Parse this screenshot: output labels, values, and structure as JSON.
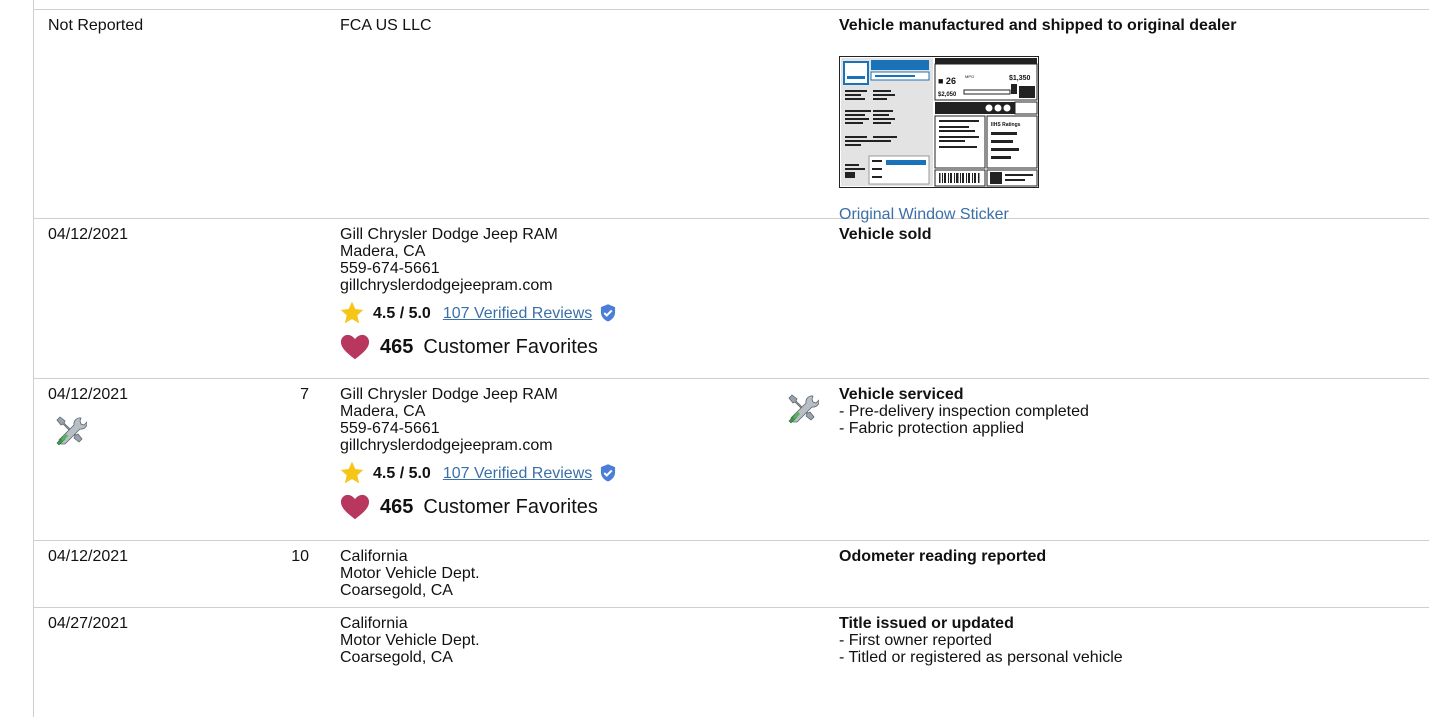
{
  "rows": [
    {
      "date": "Not Reported",
      "odometer": "",
      "source": {
        "lines": [
          "FCA US LLC"
        ]
      },
      "details": {
        "headline": "Vehicle manufactured and shipped to original dealer",
        "sticker": {
          "link_label": "Original Window Sticker",
          "mpg": "26",
          "mpg_unit": "MPG",
          "price_top": "$1,350",
          "price_bottom": "$2,050",
          "ratings_label": "IIHS Ratings"
        }
      }
    },
    {
      "date": "04/12/2021",
      "odometer": "",
      "source": {
        "lines": [
          "Gill Chrysler Dodge Jeep RAM",
          "Madera, CA",
          "559-674-5661",
          "gillchryslerdodgejeepram.com"
        ],
        "rating": {
          "score": "4.5 / 5.0",
          "reviews": "107 Verified Reviews"
        },
        "favorites": {
          "count": "465",
          "label": "Customer Favorites"
        }
      },
      "details": {
        "headline": "Vehicle sold",
        "lines": []
      }
    },
    {
      "date": "04/12/2021",
      "odometer": "7",
      "source": {
        "lines": [
          "Gill Chrysler Dodge Jeep RAM",
          "Madera, CA",
          "559-674-5661",
          "gillchryslerdodgejeepram.com"
        ],
        "rating": {
          "score": "4.5 / 5.0",
          "reviews": "107 Verified Reviews"
        },
        "favorites": {
          "count": "465",
          "label": "Customer Favorites"
        }
      },
      "details": {
        "headline": "Vehicle serviced",
        "lines": [
          "- Pre-delivery inspection completed",
          "- Fabric protection applied"
        ]
      }
    },
    {
      "date": "04/12/2021",
      "odometer": "10",
      "source": {
        "lines": [
          "California",
          "Motor Vehicle Dept.",
          "Coarsegold, CA"
        ]
      },
      "details": {
        "headline": "Odometer reading reported",
        "lines": []
      }
    },
    {
      "date": "04/27/2021",
      "odometer": "",
      "source": {
        "lines": [
          "California",
          "Motor Vehicle Dept.",
          "Coarsegold, CA"
        ]
      },
      "details": {
        "headline": "Title issued or updated",
        "lines": [
          "- First owner reported",
          "- Titled or registered as personal vehicle"
        ]
      }
    }
  ],
  "colors": {
    "link": "#3a6fa8",
    "star": "#f5c518",
    "heart": "#b8375e",
    "verified": "#4a7ed9",
    "divider": "#cfcfcf"
  },
  "icons": [
    "star-icon",
    "verified-badge-icon",
    "heart-icon",
    "service-tools-icon",
    "window-sticker-thumbnail"
  ]
}
